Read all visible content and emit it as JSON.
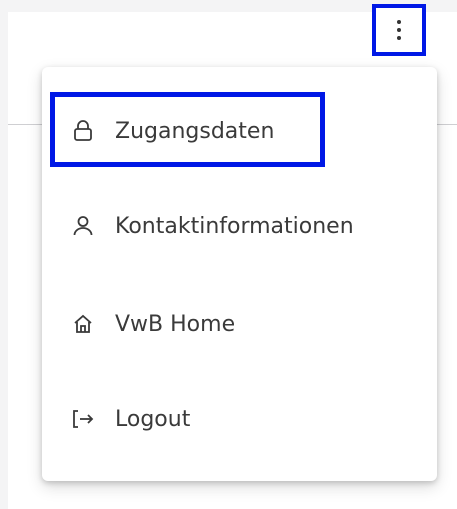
{
  "header": {
    "more_button_icon": "more-vertical-icon"
  },
  "menu": {
    "items": [
      {
        "label": "Zugangsdaten",
        "icon": "lock-icon"
      },
      {
        "label": "Kontaktinformationen",
        "icon": "person-icon"
      },
      {
        "label": "VwB Home",
        "icon": "home-icon"
      },
      {
        "label": "Logout",
        "icon": "logout-icon"
      }
    ]
  },
  "colors": {
    "highlight": "#0018e6",
    "text": "#3a3a3a"
  }
}
